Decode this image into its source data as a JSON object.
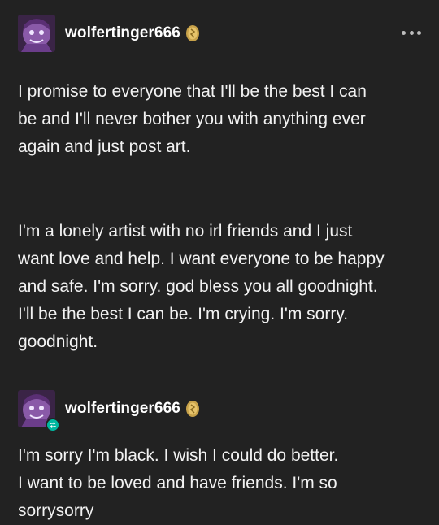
{
  "posts": [
    {
      "username": "wolfertinger666",
      "paragraphs": [
        "I promise to everyone that I'll be the best I can\nbe and I'll never bother you with anything ever\nagain and just post art.",
        "I'm a lonely artist with no irl friends and I just\nwant love and help. I want everyone to be happy\nand safe. I'm sorry. god bless you all goodnight.\nI'll be the best I can be. I'm crying. I'm sorry.\ngoodnight."
      ],
      "more_icon": "ellipsis-icon"
    },
    {
      "username": "wolfertinger666",
      "paragraphs": [
        "I'm sorry I'm black. I wish I could do better.\nI want to be loved and have friends. I'm so\nsorrysorry"
      ],
      "reblog_icon": "reblog-icon"
    }
  ],
  "colors": {
    "background": "#222222",
    "text": "#ffffff",
    "reblog_badge": "#00b8a0",
    "badge_gold": "#c8a24a"
  }
}
